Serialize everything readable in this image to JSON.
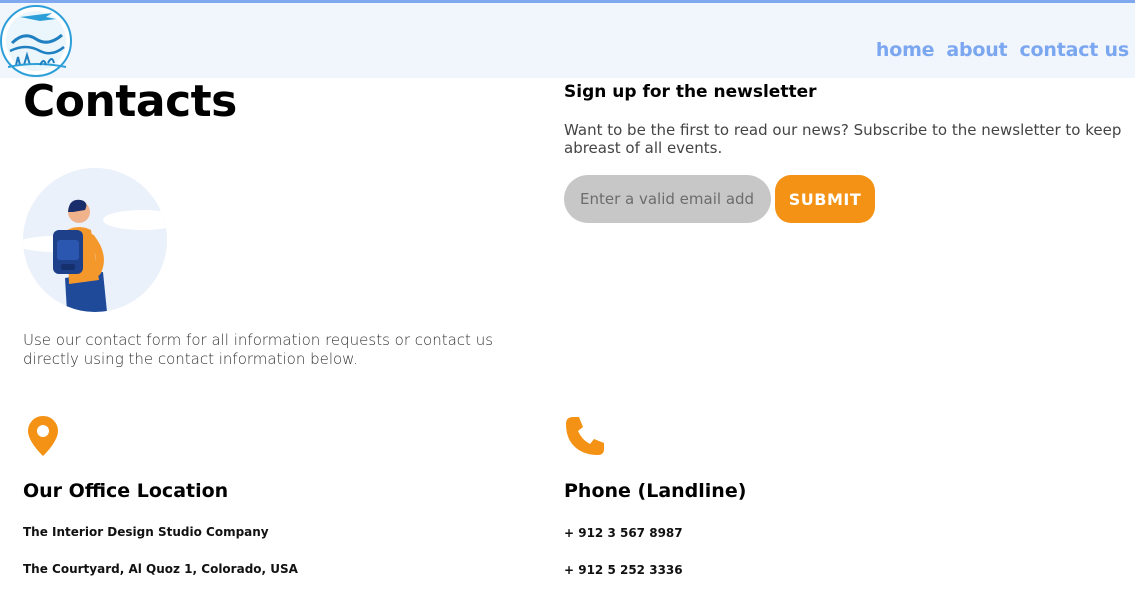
{
  "logo": {
    "alt": "The Travel Agency"
  },
  "nav": [
    {
      "label": "home"
    },
    {
      "label": "about"
    },
    {
      "label": "contact us"
    }
  ],
  "contacts": {
    "title": "Contacts",
    "intro": "Use our contact form for all information requests or contact us directly using the contact information below."
  },
  "newsletter": {
    "title": "Sign up for the newsletter",
    "text": "Want to be the first to read our news? Subscribe to the newsletter to keep abreast of all events.",
    "placeholder": "Enter a valid email address",
    "submit_label": "SUBMIT"
  },
  "office": {
    "title": "Our Office Location",
    "line1": "The Interior Design Studio Company",
    "line2": "The Courtyard, Al Quoz 1, Colorado,  USA"
  },
  "phone": {
    "title": "Phone (Landline)",
    "line1": "+ 912 3 567 8987",
    "line2": "+ 912 5 252 3336"
  },
  "colors": {
    "accent_orange": "#f39214",
    "nav_blue": "#7aa7f0",
    "header_bg": "#f1f5fc"
  }
}
